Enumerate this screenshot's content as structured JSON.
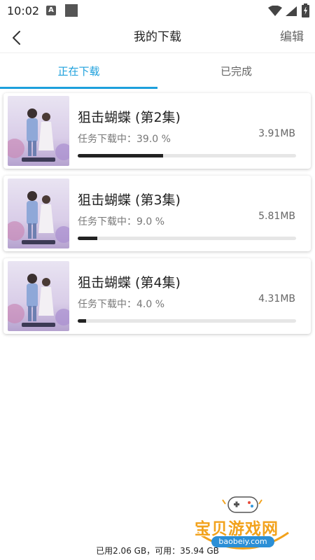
{
  "status_bar": {
    "time": "10:02",
    "a_badge": "A"
  },
  "header": {
    "title": "我的下载",
    "edit_label": "编辑"
  },
  "tabs": [
    {
      "label": "正在下载",
      "active": true
    },
    {
      "label": "已完成",
      "active": false
    }
  ],
  "downloads": [
    {
      "title": "狙击蝴蝶 (第2集)",
      "status": "任务下载中：39.0 %",
      "size": "3.91MB",
      "progress": 0.39
    },
    {
      "title": "狙击蝴蝶 (第3集)",
      "status": "任务下载中：9.0 %",
      "size": "5.81MB",
      "progress": 0.09
    },
    {
      "title": "狙击蝴蝶 (第4集)",
      "status": "任务下载中：4.0 %",
      "size": "4.31MB",
      "progress": 0.04
    }
  ],
  "storage": {
    "text": "已用2.06 GB，可用：35.94 GB"
  },
  "watermark": {
    "title": "宝贝游戏网",
    "url": "baobeiy.com"
  },
  "colors": {
    "accent": "#1da0dc",
    "progress": "#222222",
    "track": "#e6e6e6"
  }
}
